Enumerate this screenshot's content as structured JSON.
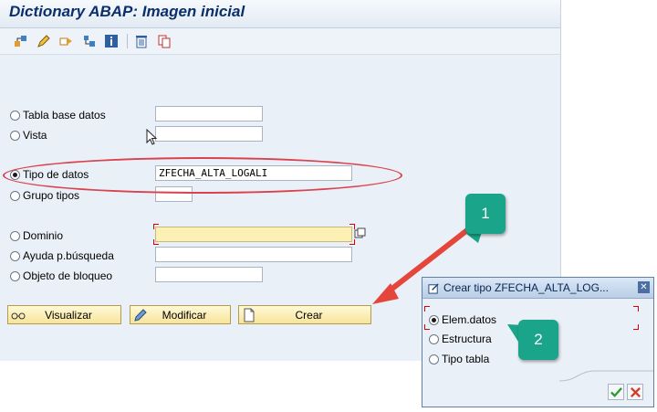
{
  "window": {
    "title": "Dictionary ABAP: Imagen inicial"
  },
  "toolbar": {
    "icons": [
      "other-object-icon",
      "edit-icon",
      "check-icon",
      "activate-icon",
      "info-icon",
      "delete-icon",
      "copy-icon"
    ]
  },
  "object_types": [
    {
      "label": "Tabla base datos",
      "value": "",
      "selected": false
    },
    {
      "label": "Vista",
      "value": "",
      "selected": false
    },
    {
      "label": "Tipo de datos",
      "value": "ZFECHA_ALTA_LOGALI",
      "selected": true
    },
    {
      "label": "Grupo tipos",
      "value": "",
      "selected": false
    },
    {
      "label": "Dominio",
      "value": "",
      "selected": false
    },
    {
      "label": "Ayuda p.búsqueda",
      "value": "",
      "selected": false
    },
    {
      "label": "Objeto de bloqueo",
      "value": "",
      "selected": false
    }
  ],
  "buttons": {
    "display": "Visualizar",
    "change": "Modificar",
    "create": "Crear"
  },
  "dialog": {
    "title": "Crear tipo ZFECHA_ALTA_LOG...",
    "options": [
      {
        "label": "Elem.datos",
        "selected": true
      },
      {
        "label": "Estructura",
        "selected": false
      },
      {
        "label": "Tipo tabla",
        "selected": false
      }
    ]
  },
  "callouts": {
    "step1": "1",
    "step2": "2"
  },
  "colors": {
    "accent": "#1aa58a",
    "arrow": "#e5463b",
    "title": "#0b2f6b"
  }
}
